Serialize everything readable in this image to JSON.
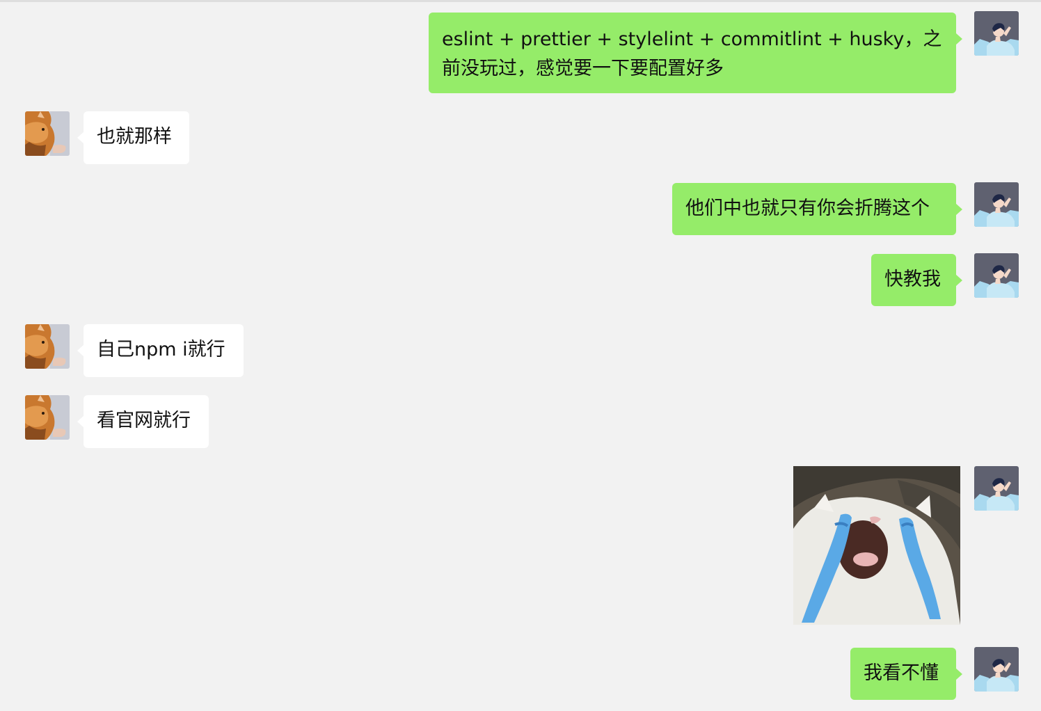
{
  "messages": [
    {
      "id": 1,
      "sender": "me",
      "text": "eslint + prettier + stylelint + commitlint + husky，之前没玩过，感觉要一下要配置好多"
    },
    {
      "id": 2,
      "sender": "other",
      "text": "也就那样"
    },
    {
      "id": 3,
      "sender": "me",
      "text": "他们中也就只有你会折腾这个"
    },
    {
      "id": 4,
      "sender": "me",
      "text": "快教我"
    },
    {
      "id": 5,
      "sender": "other",
      "text": "自己npm i就行"
    },
    {
      "id": 6,
      "sender": "other",
      "text": "看官网就行"
    },
    {
      "id": 7,
      "sender": "me",
      "type": "image",
      "image": "crying-cat-meme"
    },
    {
      "id": 8,
      "sender": "me",
      "text": "我看不懂"
    }
  ],
  "avatars": {
    "me": "illustrated-man-avatar",
    "other": "orange-cat-avatar"
  },
  "colors": {
    "background": "#f2f2f2",
    "my_bubble": "#95ec69",
    "other_bubble": "#ffffff",
    "text": "#111111"
  }
}
